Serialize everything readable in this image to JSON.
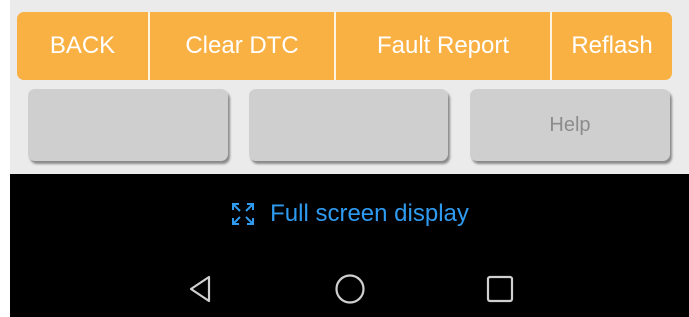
{
  "toolbar": {
    "back_label": "BACK",
    "clear_dtc_label": "Clear DTC",
    "fault_report_label": "Fault Report",
    "reflash_label": "Reflash"
  },
  "function_buttons": {
    "button_1_label": "",
    "button_2_label": "",
    "help_label": "Help"
  },
  "fullscreen": {
    "icon": "expand-icon",
    "label": "Full screen display"
  },
  "nav_bar": {
    "back_icon": "triangle-back-icon",
    "home_icon": "circle-home-icon",
    "recents_icon": "square-recents-icon"
  },
  "colors": {
    "accent": "#f9b144",
    "button_grey": "#cfcfcf",
    "link_blue": "#2f9bf0",
    "nav_background": "#000000"
  }
}
